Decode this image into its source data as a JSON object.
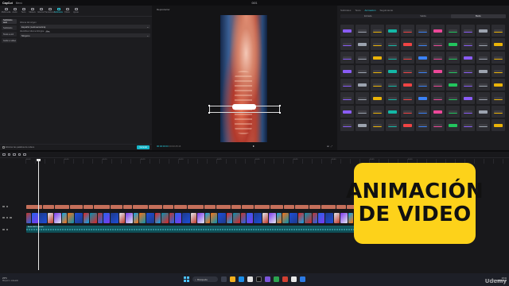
{
  "window": {
    "app_logo": "CapCut",
    "menu_label": "Menú",
    "project_title": "0601",
    "buttons": [
      "Pro",
      "Compartir",
      "Exportar"
    ]
  },
  "left_panel": {
    "tools": [
      "Multimedia",
      "Audio",
      "Texto",
      "Stickers",
      "Efectos",
      "Transiciones",
      "Subtítulos",
      "Filtros",
      "Ajuste"
    ],
    "active_tool_index": 6,
    "subnav": [
      "Subtítulos auto",
      "Subtítulos",
      "Texto a voz",
      "Guión a video"
    ],
    "subnav_active_index": 0,
    "fields": [
      {
        "label": "Idioma del origen",
        "value": "Español (Latinoamérica)"
      },
      {
        "label": "Identificar idioma bilingüe",
        "badge": "Pro",
        "value": "Ninguno"
      }
    ],
    "footer_check_label": "Eliminar las palabras de relleno",
    "footer_button": "Generar"
  },
  "player": {
    "title": "Reproductor",
    "current_time": "00:00:00:00",
    "total_time": "00:03:25:16",
    "controls": [
      "⊞",
      "⤢"
    ]
  },
  "right_panel": {
    "tabs": [
      "Subtítulos",
      "Texto",
      "Animación",
      "Seguimiento"
    ],
    "active_tab_index": 2,
    "subtabs": [
      "Entrada",
      "Salida",
      "Bucle"
    ],
    "active_subtab_index": 2,
    "tile_colors": [
      "#8a5cf6",
      "#3b82f6",
      "#eab308",
      "#22c55e",
      "#ef4444",
      "#9ca3af",
      "#ec4899",
      "#14b8a6"
    ],
    "tile_count": 88
  },
  "timeline": {
    "ruler_labels": [
      "00:00",
      "00:05",
      "00:10",
      "00:15",
      "00:20",
      "00:25",
      "00:30",
      "00:35",
      "00:40",
      "00:45",
      "00:50"
    ],
    "audio_clip_label": "Audio 0601 extraído",
    "text_clip_color": "#c56f5a",
    "video_clip_colors": [
      "#c0392b",
      "#2563eb",
      "#1e3a8a",
      "#e2e8f0",
      "#7c3aed",
      "#0ea5e9",
      "#f97316",
      "#1d4ed8",
      "#dc2626",
      "#0891b2"
    ]
  },
  "overlay": {
    "line1": "ANIMACIÓN",
    "line2": "DE VIDEO",
    "background": "#fdd21a"
  },
  "taskbar": {
    "weather_temp": "23°C",
    "weather_desc": "Mayorm. soleado",
    "search_placeholder": "Búsqueda",
    "time": "10:41",
    "date": "01/06/2024",
    "watermark": "Udemy"
  }
}
